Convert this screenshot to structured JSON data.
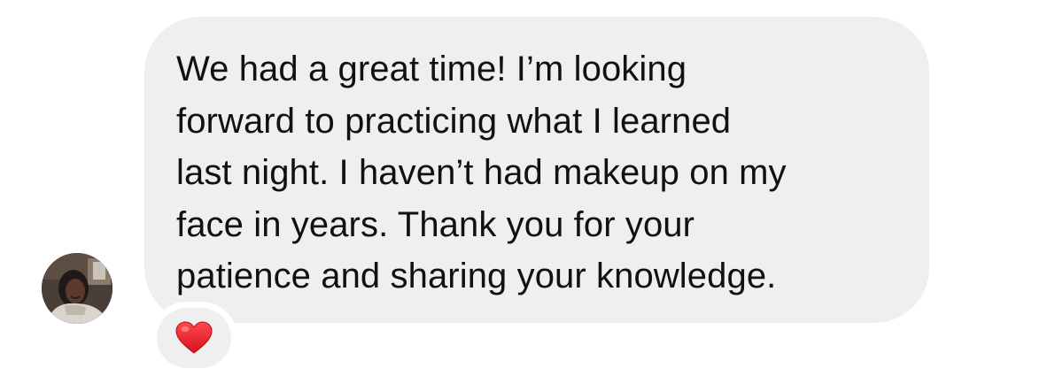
{
  "message": {
    "text": "We had a great time!  I’m looking\nforward to practicing what I learned\nlast night. I haven’t had makeup on my\nface in years. Thank you for your\npatience and sharing your knowledge."
  },
  "reaction": {
    "icon": "red-heart-icon",
    "color": "#e8202a"
  },
  "avatar": {
    "icon": "user-avatar-photo"
  },
  "colors": {
    "bubble": "#efefef",
    "text": "#111111",
    "background": "#ffffff"
  }
}
